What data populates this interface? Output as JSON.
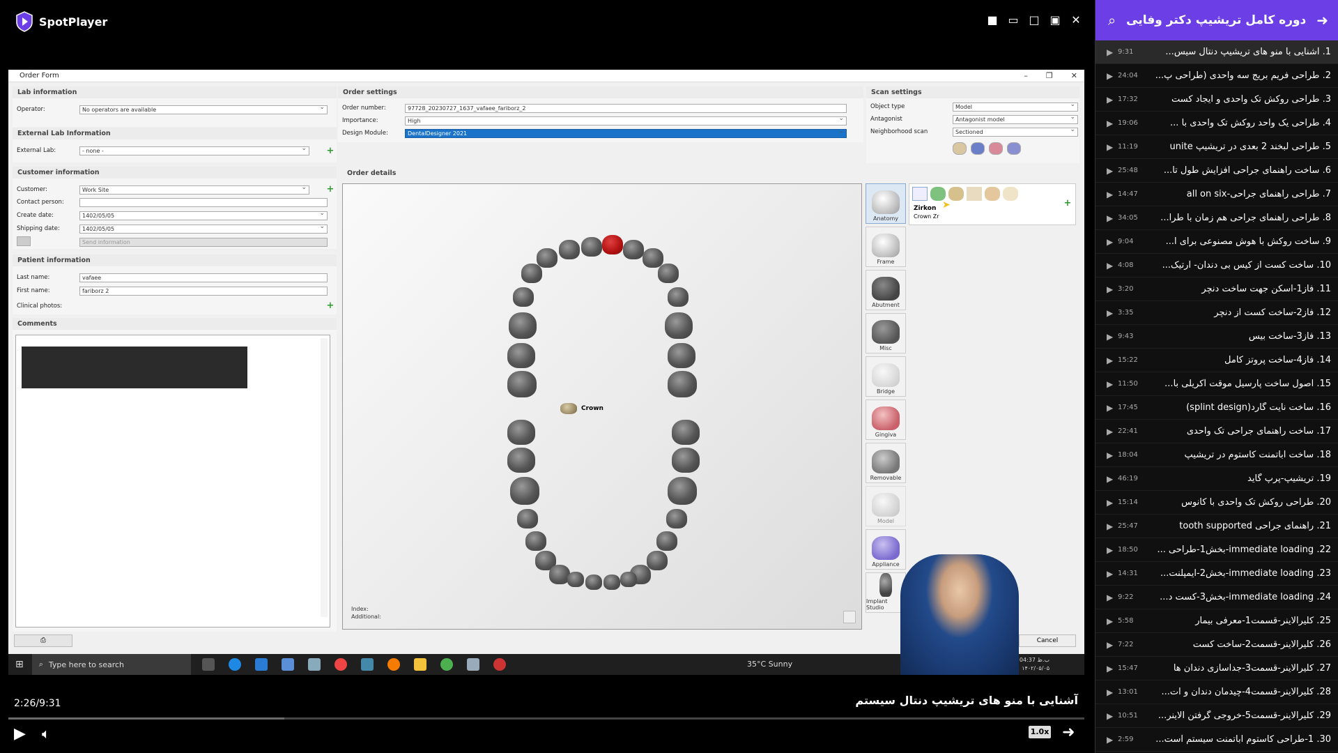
{
  "player": {
    "brand": "SpotPlayer",
    "time_display": "2:26/9:31",
    "current_title": "آشنایی با منو های تریشیپ دنتال سیستم",
    "speed": "1.0x",
    "progress_fraction": 0.2566
  },
  "order_form": {
    "window_title": "Order Form",
    "lab": {
      "header": "Lab information",
      "operator_label": "Operator:",
      "operator_value": "No operators are available",
      "ext_header": "External Lab Information",
      "ext_label": "External Lab:",
      "ext_value": "- none -"
    },
    "customer": {
      "header": "Customer information",
      "customer_label": "Customer:",
      "customer_value": "Work Site",
      "contact_label": "Contact person:",
      "create_label": "Create date:",
      "create_value": "1402/05/05",
      "ship_label": "Shipping date:",
      "ship_value": "1402/05/05",
      "send_info": "Send information"
    },
    "patient": {
      "header": "Patient information",
      "last_label": "Last name:",
      "last_value": "vafaee",
      "first_label": "First name:",
      "first_value": "fariborz 2",
      "photos_label": "Clinical photos:"
    },
    "comments_header": "Comments",
    "order_settings": {
      "header": "Order settings",
      "number_label": "Order number:",
      "number_value": "97728_20230727_1637_vafaee_fariborz_2",
      "importance_label": "Importance:",
      "importance_value": "High",
      "module_label": "Design Module:",
      "module_value": "DentalDesigner 2021"
    },
    "scan_settings": {
      "header": "Scan settings",
      "object_label": "Object type",
      "object_value": "Model",
      "antagonist_label": "Antagonist",
      "antagonist_value": "Antagonist model",
      "neighbor_label": "Neighborhood scan",
      "neighbor_value": "Sectioned"
    },
    "order_details_header": "Order details",
    "crown_label": "Crown",
    "index_label": "Index:",
    "additional_label": "Additional:",
    "material": {
      "name": "Zirkon",
      "type": "Crown Zr"
    },
    "tools": [
      "Anatomy",
      "Frame",
      "Abutment",
      "Misc",
      "Bridge",
      "Gingiva",
      "Removable",
      "Model",
      "Appliance",
      "Implant Studio"
    ],
    "cancel_label": "Cancel"
  },
  "taskbar": {
    "search_placeholder": "Type here to search",
    "weather": "35°C  Sunny",
    "clock_line1": "ب.ظ 04:37",
    "clock_line2": "۱۴۰۲/۰۵/۰۵"
  },
  "sidebar": {
    "title": "دوره کامل تریشیپ دکتر وفایی",
    "items": [
      {
        "label": "1. آشنایی با منو های تریشیپ دنتال سیس...",
        "duration": "9:31"
      },
      {
        "label": "2. طراحی فریم بریج سه واحدی (طراحی پ...",
        "duration": "24:04"
      },
      {
        "label": "3. طراحی روکش تک واحدی و ایجاد کست",
        "duration": "17:32"
      },
      {
        "label": "4. طراحی یک واحد روکش تک واحدی با ...",
        "duration": "19:06"
      },
      {
        "label": "5. طراحی لبخند 2 بعدی در تریشیپ unite",
        "duration": "11:19"
      },
      {
        "label": "6. ساخت راهنمای جراحی افزایش طول تا...",
        "duration": "25:48"
      },
      {
        "label": "7. طراحی راهنمای جراحی-all on six",
        "duration": "14:47"
      },
      {
        "label": "8. طراحی راهنمای جراحی هم زمان با طرا...",
        "duration": "34:05"
      },
      {
        "label": "9. ساخت روکش  با هوش مصنوعی برای ا...",
        "duration": "9:04"
      },
      {
        "label": "10. ساخت کست از کیس بی دندان- آرتیک...",
        "duration": "4:08"
      },
      {
        "label": "11. فاز1-اسکن جهت ساخت دنچر",
        "duration": "3:20"
      },
      {
        "label": "12. فاز2-ساخت کست از دنچر",
        "duration": "3:35"
      },
      {
        "label": "13. فاز3-ساخت بیس",
        "duration": "9:43"
      },
      {
        "label": "14. فاز4-ساخت پروتز کامل",
        "duration": "15:22"
      },
      {
        "label": "15. اصول ساخت پارسیل موقت آکریلی با...",
        "duration": "11:50"
      },
      {
        "label": "16. ساخت نایت گارد(splint design)",
        "duration": "17:45"
      },
      {
        "label": "17. ساخت راهنمای جراحی تک واحدی",
        "duration": "22:41"
      },
      {
        "label": "18. ساخت اباتمنت کاستوم در تریشیپ",
        "duration": "18:04"
      },
      {
        "label": "19. تریشیپ-پرپ گاید",
        "duration": "46:19"
      },
      {
        "label": "20. طراحی روکش تک واحدی با کانوس",
        "duration": "15:14"
      },
      {
        "label": "21. راهنمای جراحی  tooth supported",
        "duration": "25:47"
      },
      {
        "label": "22. immediate loading-بخش1-طراحی ...",
        "duration": "18:50"
      },
      {
        "label": "23. immediate loading-بخش2-ایمپلنت...",
        "duration": "14:31"
      },
      {
        "label": "24. immediate loading-بخش3-کست د...",
        "duration": "9:22"
      },
      {
        "label": "25. کلیرالاینر-قسمت1-معرفی بیمار",
        "duration": "5:58"
      },
      {
        "label": "26. کلیرالاینر-قسمت2-ساخت کست",
        "duration": "7:22"
      },
      {
        "label": "27. کلیرالاینر-قسمت3-جداسازی دندان ها",
        "duration": "15:47"
      },
      {
        "label": "28. کلیرالاینر-قسمت4-چیدمان دندان و ات...",
        "duration": "13:01"
      },
      {
        "label": "29. کلیرالاینر-قسمت5-خروجی گرفتن الاینر...",
        "duration": "10:51"
      },
      {
        "label": "30. 1-طراحی کاستوم اباتمنت سیستم آست...",
        "duration": "2:59"
      }
    ]
  },
  "colors": {
    "accent": "#6b3ee6"
  }
}
